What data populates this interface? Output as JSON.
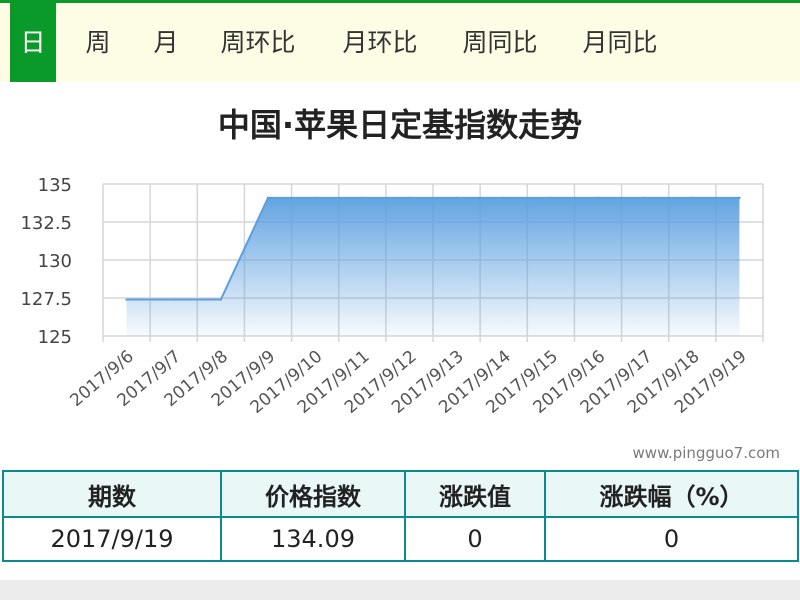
{
  "tabs": [
    {
      "label": "日",
      "active": true
    },
    {
      "label": "周"
    },
    {
      "label": "月"
    },
    {
      "label": "周环比"
    },
    {
      "label": "月环比"
    },
    {
      "label": "周同比"
    },
    {
      "label": "月同比"
    }
  ],
  "colors": {
    "accent": "#0a9a2a",
    "series": "#5b9fe0",
    "table_border": "#0b8a92"
  },
  "watermark": "www.pingguo7.com",
  "chart_data": {
    "type": "area",
    "title": "中国·苹果日定基指数走势",
    "x": [
      "2017/9/6",
      "2017/9/7",
      "2017/9/8",
      "2017/9/9",
      "2017/9/10",
      "2017/9/11",
      "2017/9/12",
      "2017/9/13",
      "2017/9/14",
      "2017/9/15",
      "2017/9/16",
      "2017/9/17",
      "2017/9/18",
      "2017/9/19"
    ],
    "series": [
      {
        "values": [
          127.4,
          127.4,
          127.4,
          134.09,
          134.09,
          134.09,
          134.09,
          134.09,
          134.09,
          134.09,
          134.09,
          134.09,
          134.09,
          134.09
        ]
      }
    ],
    "ylim": [
      125,
      135
    ],
    "yticks": [
      "125",
      "127.5",
      "130",
      "132.5",
      "135"
    ],
    "grid": true
  },
  "table": {
    "headers": [
      "期数",
      "价格指数",
      "涨跌值",
      "涨跌幅（%）"
    ],
    "rows": [
      [
        "2017/9/19",
        "134.09",
        "0",
        "0"
      ]
    ]
  }
}
